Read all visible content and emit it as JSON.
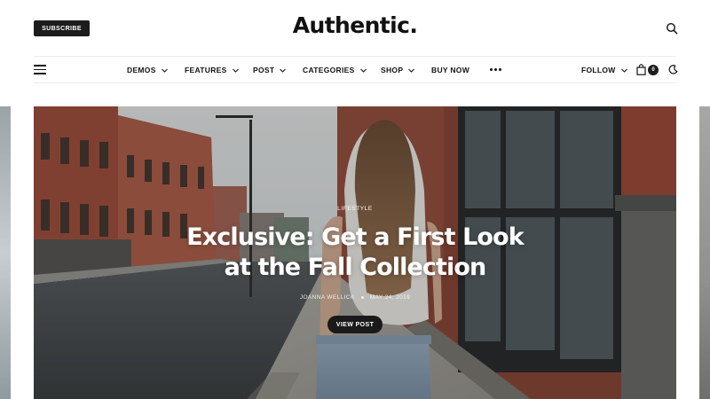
{
  "header": {
    "subscribe_label": "SUBSCRIBE",
    "logo": "Authentic.",
    "icons": {
      "search": "search-icon"
    }
  },
  "nav": {
    "menu_icon": "hamburger-icon",
    "items": [
      {
        "label": "DEMOS",
        "has_dropdown": true
      },
      {
        "label": "FEATURES",
        "has_dropdown": true
      },
      {
        "label": "POST",
        "has_dropdown": true
      },
      {
        "label": "CATEGORIES",
        "has_dropdown": true
      },
      {
        "label": "SHOP",
        "has_dropdown": true
      },
      {
        "label": "BUY NOW",
        "has_dropdown": false
      }
    ],
    "more_icon": "more-dots-icon",
    "follow_label": "FOLLOW",
    "cart_count": "0",
    "theme_icon": "moon-icon"
  },
  "hero": {
    "category": "LIFESTYLE",
    "title_line1": "Exclusive: Get a First Look",
    "title_line2": "at the Fall Collection",
    "author": "JOANNA WELLICK",
    "date": "MAY 24, 2019",
    "button_label": "VIEW POST"
  },
  "colors": {
    "accent": "#1c1c1c",
    "text": "#111111",
    "divider": "#ececec",
    "hero_text": "#ffffff"
  }
}
